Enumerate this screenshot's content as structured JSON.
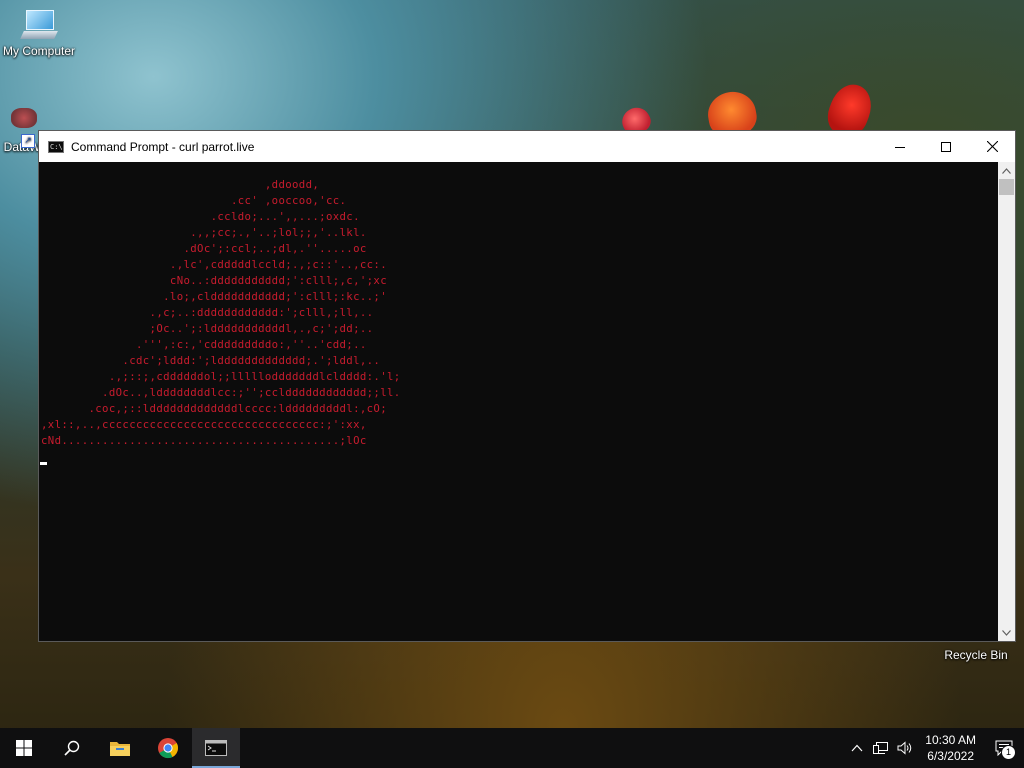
{
  "desktop": {
    "icons": [
      {
        "label": "My Computer",
        "icon": "computer-icon"
      },
      {
        "label": "DataW",
        "icon": "shortcut-icon"
      },
      {
        "label": "Recycle Bin",
        "icon": "recycle-bin-icon"
      }
    ]
  },
  "window": {
    "title": "Command Prompt - curl  parrot.live",
    "icon": "cmd-icon",
    "controls": [
      "minimize",
      "maximize",
      "close"
    ],
    "text_color": "#c81c2e",
    "background": "#0c0c0c",
    "console_lines": [
      "                                 ,ddoodd,",
      "                            .cc' ,ooccoo,'cc.",
      "                         .ccldo;...',,...;oxdc.",
      "                      .,,;cc;.,'..;lol;;,'..lkl.",
      "                     .dOc';:ccl;..;dl,.''.....oc",
      "                   .,lc',cdddddlccld;.,;c::'..,cc:.",
      "                   cNo..:ddddddddddd;':clll;,c,';xc",
      "                  .lo;,clddddddddddd;':clll;:kc..;'",
      "                .,c;..:dddddddddddd:';clll,;ll,..",
      "                ;Oc..';:ldddddddddddl,.,c;';dd;..",
      "              .''',:c:,'cdddddddddo:,''..'cdd;..",
      "            .cdc';lddd:';lddddddddddddd;.';lddl,..",
      "          .,;::;,cddddddol;;lllllodddddddlcldddd:.'l;",
      "         .dOc..,lddddddddlcc:;'';ccldddddddddddd;;ll.",
      "       .coc,;::ldddddddddddddlcccc:ldddddddddl:,cO;",
      ",xl::,..,cccccccccccccccccccccccccccccccc:;':xx,",
      "cNd.........................................;lOc"
    ]
  },
  "taskbar": {
    "items": [
      {
        "name": "start",
        "icon": "windows-icon"
      },
      {
        "name": "search",
        "icon": "search-icon"
      },
      {
        "name": "file-explorer",
        "icon": "folder-icon"
      },
      {
        "name": "chrome",
        "icon": "chrome-icon"
      },
      {
        "name": "command-prompt",
        "icon": "cmd-icon",
        "active": true
      }
    ],
    "tray": {
      "icons": [
        "chevron-up-icon",
        "network-icon",
        "volume-icon"
      ],
      "time": "10:30 AM",
      "date": "6/3/2022",
      "notification_count": "1"
    }
  }
}
